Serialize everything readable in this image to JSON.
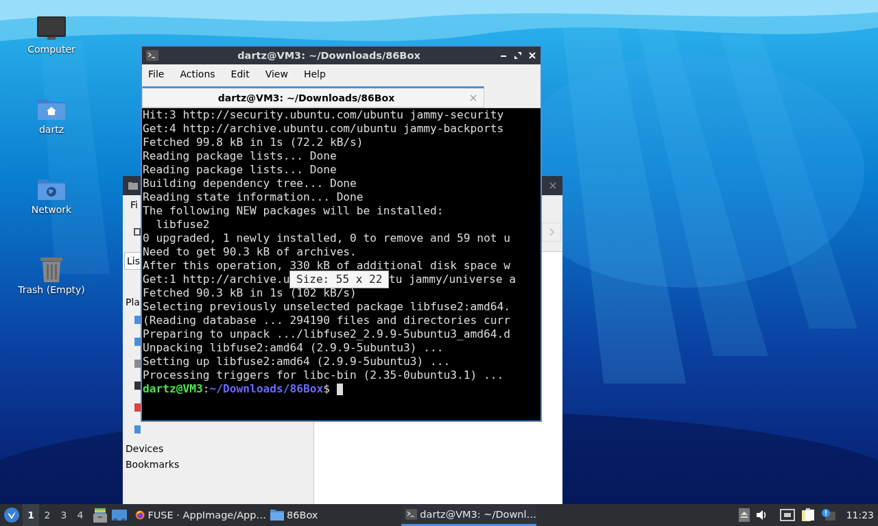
{
  "desktop_icons": [
    {
      "label": "Computer",
      "kind": "computer"
    },
    {
      "label": "dartz",
      "kind": "home"
    },
    {
      "label": "Network",
      "kind": "network"
    },
    {
      "label": "Trash (Empty)",
      "kind": "trash"
    }
  ],
  "file_manager": {
    "menu_fragment": "Fi",
    "view_fragment": "Lis",
    "places_fragment": "Pla",
    "sections": [
      "Devices",
      "Bookmarks"
    ]
  },
  "terminal": {
    "title": "dartz@VM3: ~/Downloads/86Box",
    "menu": [
      "File",
      "Actions",
      "Edit",
      "View",
      "Help"
    ],
    "tabs": [
      {
        "label": "dartz@VM3: ~/Downloads/86Box",
        "selected": true
      }
    ],
    "lines": [
      {
        "parts": [
          "Hit:3 http://security.ubuntu.com/ubuntu jammy-security"
        ]
      },
      {
        "parts": [
          "Get:4 http://archive.ubuntu.com/ubuntu jammy-backports"
        ]
      },
      {
        "parts": [
          "Fetched 99.8 kB in 1s (72.2 kB/s)"
        ]
      },
      {
        "parts": [
          "Reading package lists... Done"
        ]
      },
      {
        "parts": [
          "Reading package lists... Done"
        ]
      },
      {
        "parts": [
          "Building dependency tree... Done"
        ]
      },
      {
        "parts": [
          "Reading state information... Done"
        ]
      },
      {
        "parts": [
          "The following NEW packages will be installed:"
        ]
      },
      {
        "parts": [
          "  libfuse2"
        ]
      },
      {
        "parts": [
          "0 upgraded, 1 newly installed, 0 to remove and 59 not u"
        ]
      },
      {
        "parts": [
          "Need to get 90.3 kB of archives."
        ]
      },
      {
        "parts": [
          "After this operation, 330 kB of additional disk space w"
        ]
      },
      {
        "parts": [
          "Get:1 http://archive.u",
          "tu jammy/universe a"
        ]
      },
      {
        "parts": [
          "Fetched 90.3 kB in 1s (102 kB/s)"
        ]
      },
      {
        "parts": [
          "Selecting previously unselected package libfuse2:amd64."
        ]
      },
      {
        "parts": [
          "(Reading database ... 294190 files and directories curr"
        ]
      },
      {
        "parts": [
          "Preparing to unpack .../libfuse2_2.9.9-5ubuntu3_amd64.d"
        ]
      },
      {
        "parts": [
          "Unpacking libfuse2:amd64 (2.9.9-5ubuntu3) ..."
        ]
      },
      {
        "parts": [
          "Setting up libfuse2:amd64 (2.9.9-5ubuntu3) ..."
        ]
      },
      {
        "parts": [
          "Processing triggers for libc-bin (2.35-0ubuntu3.1) ..."
        ]
      }
    ],
    "prompt": {
      "user_host": "dartz@VM3",
      "separator": ":",
      "path": "~/Downloads/86Box",
      "symbol": "$"
    },
    "tooltip": "Size: 55 x 22"
  },
  "taskbar": {
    "workspaces": [
      {
        "label": "1",
        "selected": true
      },
      {
        "label": "2",
        "selected": false
      },
      {
        "label": "3",
        "selected": false
      },
      {
        "label": "4",
        "selected": false
      }
    ],
    "tasks": [
      {
        "label": "FUSE · AppImage/App…",
        "kind": "browser",
        "selected": false
      },
      {
        "label": "86Box",
        "kind": "folder",
        "selected": false
      },
      {
        "label": "dartz@VM3: ~/Downl…",
        "kind": "terminal",
        "selected": true
      }
    ],
    "clock": "11:23"
  }
}
